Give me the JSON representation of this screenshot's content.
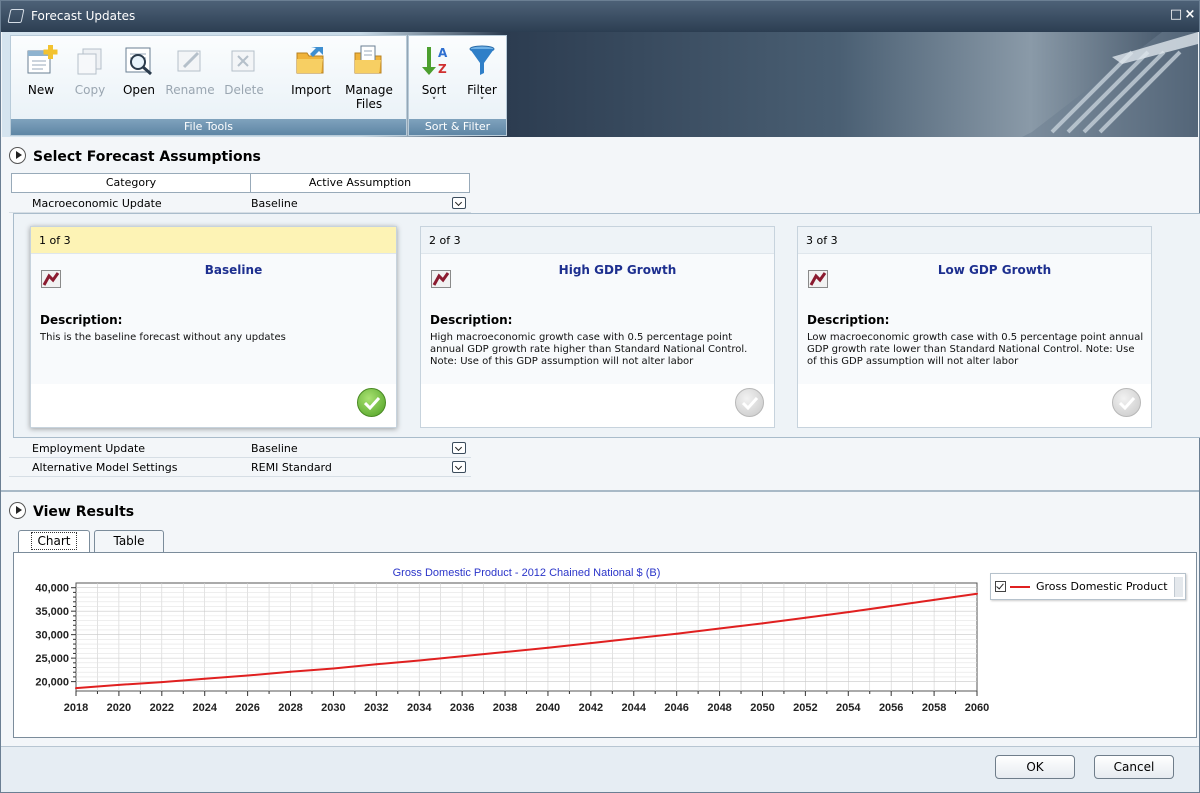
{
  "window": {
    "title": "Forecast Updates",
    "restore_glyph": "□",
    "close_glyph": "×"
  },
  "ribbon": {
    "file_tools_label": "File Tools",
    "sort_filter_label": "Sort & Filter",
    "buttons": [
      {
        "label": "New",
        "icon": "new-document-icon",
        "enabled": true
      },
      {
        "label": "Copy",
        "icon": "copy-icon",
        "enabled": false
      },
      {
        "label": "Open",
        "icon": "open-search-icon",
        "enabled": true
      },
      {
        "label": "Rename",
        "icon": "rename-icon",
        "enabled": false
      },
      {
        "label": "Delete",
        "icon": "delete-icon",
        "enabled": false
      },
      {
        "label": "Import",
        "icon": "import-folder-icon",
        "enabled": true
      },
      {
        "label": "Manage",
        "label2": "Files",
        "icon": "manage-files-icon",
        "enabled": true
      },
      {
        "label": "Sort",
        "icon": "sort-az-icon",
        "caret": "˅"
      },
      {
        "label": "Filter",
        "icon": "filter-funnel-icon",
        "caret": "˅"
      }
    ]
  },
  "assumptions": {
    "heading": "Select Forecast Assumptions",
    "col_category": "Category",
    "col_active": "Active Assumption",
    "rows": [
      {
        "category": "Macroeconomic Update",
        "value": "Baseline"
      },
      {
        "category": "Employment Update",
        "value": "Baseline"
      },
      {
        "category": "Alternative Model Settings",
        "value": "REMI Standard"
      }
    ],
    "cards": [
      {
        "index": "1 of 3",
        "title": "Baseline",
        "desc_label": "Description:",
        "desc": "This is the baseline forecast without any updates",
        "selected": true
      },
      {
        "index": "2 of 3",
        "title": "High GDP Growth",
        "desc_label": "Description:",
        "desc": "High macroeconomic growth case with 0.5 percentage point annual GDP growth rate higher than Standard National Control. Note: Use of this GDP assumption will not alter labor",
        "selected": false
      },
      {
        "index": "3 of 3",
        "title": "Low GDP Growth",
        "desc_label": "Description:",
        "desc": "Low macroeconomic growth case with 0.5 percentage point annual GDP growth rate lower than Standard National Control. Note: Use of this GDP assumption will not alter labor",
        "selected": false
      }
    ]
  },
  "results": {
    "heading": "View Results",
    "tabs": [
      "Chart",
      "Table"
    ],
    "active_tab": "Chart"
  },
  "chart_data": {
    "type": "line",
    "title": "Gross Domestic Product - 2012 Chained National $ (B)",
    "xlabel": "",
    "ylabel": "",
    "x_ticks": [
      "2018",
      "2020",
      "2022",
      "2024",
      "2026",
      "2028",
      "2030",
      "2032",
      "2034",
      "2036",
      "2038",
      "2040",
      "2042",
      "2044",
      "2046",
      "2048",
      "2050",
      "2052",
      "2054",
      "2056",
      "2058",
      "2060"
    ],
    "y_ticks": [
      "40,000",
      "35,000",
      "30,000",
      "25,000",
      "20,000"
    ],
    "xlim": [
      2018,
      2060
    ],
    "ylim": [
      18000,
      41000
    ],
    "grid": true,
    "legend_position": "right",
    "series": [
      {
        "name": "Gross Domestic Product",
        "color": "#e02020",
        "x": [
          2018,
          2020,
          2022,
          2024,
          2026,
          2028,
          2030,
          2032,
          2034,
          2036,
          2038,
          2040,
          2042,
          2044,
          2046,
          2048,
          2050,
          2052,
          2054,
          2056,
          2058,
          2060
        ],
        "values": [
          18600,
          19300,
          19900,
          20600,
          21300,
          22100,
          22800,
          23700,
          24500,
          25400,
          26300,
          27200,
          28200,
          29200,
          30200,
          31300,
          32400,
          33600,
          34800,
          36100,
          37400,
          38700
        ]
      }
    ]
  },
  "footer": {
    "ok": "OK",
    "cancel": "Cancel"
  }
}
